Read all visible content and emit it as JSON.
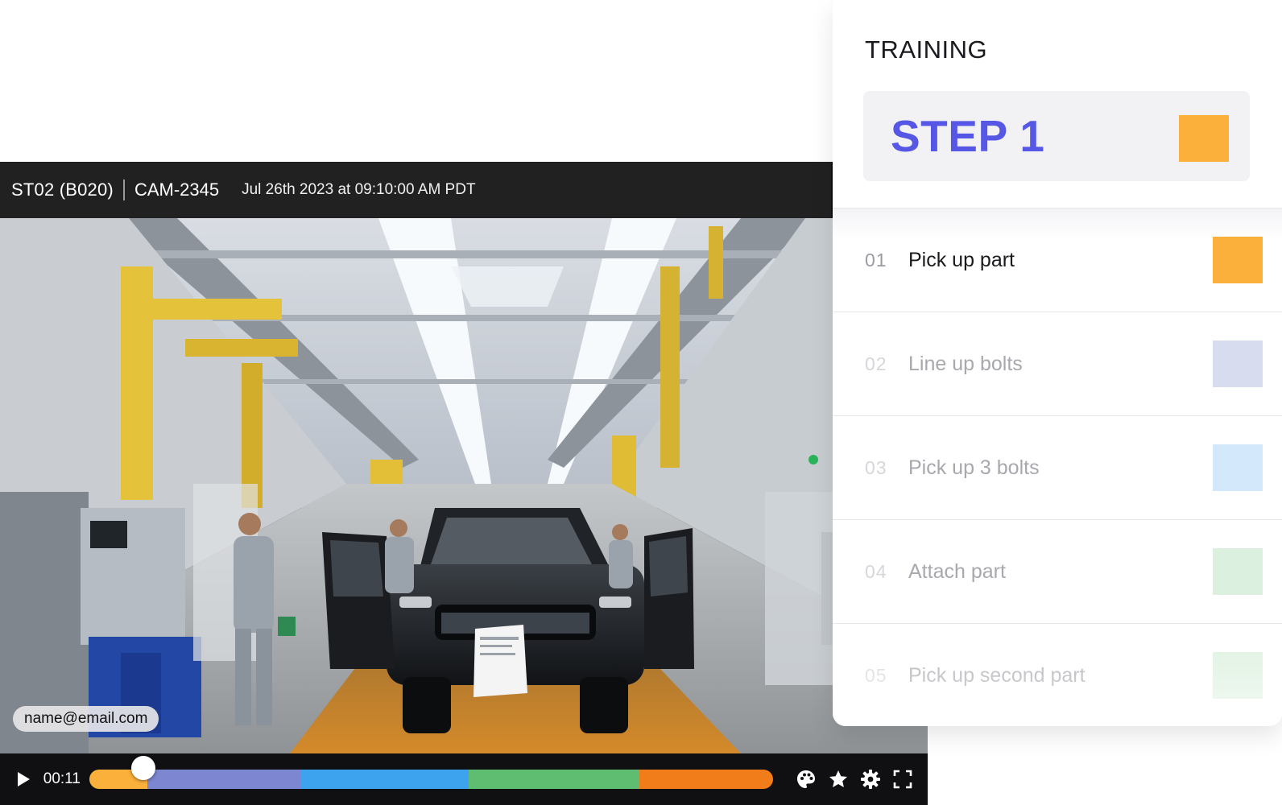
{
  "player": {
    "station": "ST02 (B020)",
    "camera": "CAM-2345",
    "timestamp": "Jul 26th 2023 at 09:10:00 AM PDT",
    "user_email": "name@email.com",
    "current_time": "00:11",
    "progress_fraction": 0.05,
    "timeline_segments": [
      {
        "color": "#fbb03b",
        "fraction": 0.085
      },
      {
        "color": "#7d86d1",
        "fraction": 0.225
      },
      {
        "color": "#3ea3ee",
        "fraction": 0.245
      },
      {
        "color": "#5fbd72",
        "fraction": 0.25
      },
      {
        "color": "#f07d1a",
        "fraction": 0.195
      }
    ],
    "icons": [
      "play-icon",
      "palette-icon",
      "star-icon",
      "gear-icon",
      "fullscreen-icon"
    ]
  },
  "training": {
    "title": "TRAINING",
    "current_step_label": "STEP 1",
    "current_step_color": "#fbb03b",
    "steps": [
      {
        "number": "01",
        "name": "Pick up part",
        "color": "#fbb03b",
        "active": true
      },
      {
        "number": "02",
        "name": "Line up bolts",
        "color": "#d8dcef",
        "active": false
      },
      {
        "number": "03",
        "name": "Pick up 3 bolts",
        "color": "#d4e8fb",
        "active": false
      },
      {
        "number": "04",
        "name": "Attach part",
        "color": "#dbf0de",
        "active": false
      },
      {
        "number": "05",
        "name": "Pick up second part",
        "color": "#dbf0de",
        "active": false
      }
    ]
  }
}
